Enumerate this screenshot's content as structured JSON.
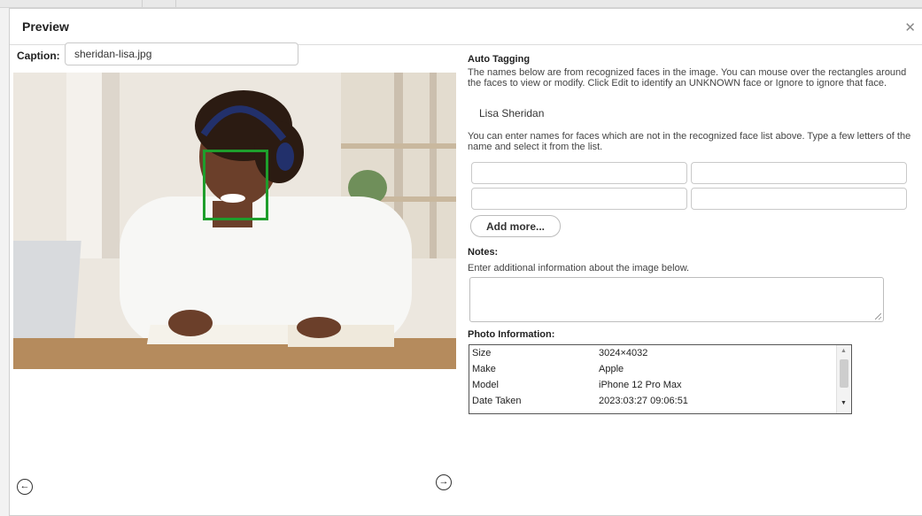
{
  "dialog": {
    "title": "Preview",
    "close_glyph": "✕"
  },
  "caption": {
    "label": "Caption:",
    "value": "sheridan-lisa.jpg"
  },
  "photo": {
    "description_icon": "image-of-student-with-headphones"
  },
  "auto_tagging": {
    "title": "Auto Tagging",
    "intro": "The names below are from recognized faces in the image. You can mouse over the rectangles around the faces to view or modify. Click Edit to identify an UNKNOWN face or Ignore to ignore that face.",
    "recognized": [
      "Lisa Sheridan"
    ],
    "manual_hint": "You can enter names for faces which are not in the recognized face list above. Type a few letters of the name and select it from the list.",
    "add_more_label": "Add more..."
  },
  "notes": {
    "title": "Notes:",
    "hint": "Enter additional information about the image below."
  },
  "photo_info": {
    "title": "Photo Information:",
    "rows": [
      {
        "key": "Size",
        "value": "3024×4032"
      },
      {
        "key": "Make",
        "value": "Apple"
      },
      {
        "key": "Model",
        "value": "iPhone 12 Pro Max"
      },
      {
        "key": "Date Taken",
        "value": "2023:03:27 09:06:51"
      }
    ]
  },
  "nav": {
    "prev_glyph": "←",
    "next_glyph": "→"
  },
  "colors": {
    "face_box": "#1e9e2c"
  }
}
